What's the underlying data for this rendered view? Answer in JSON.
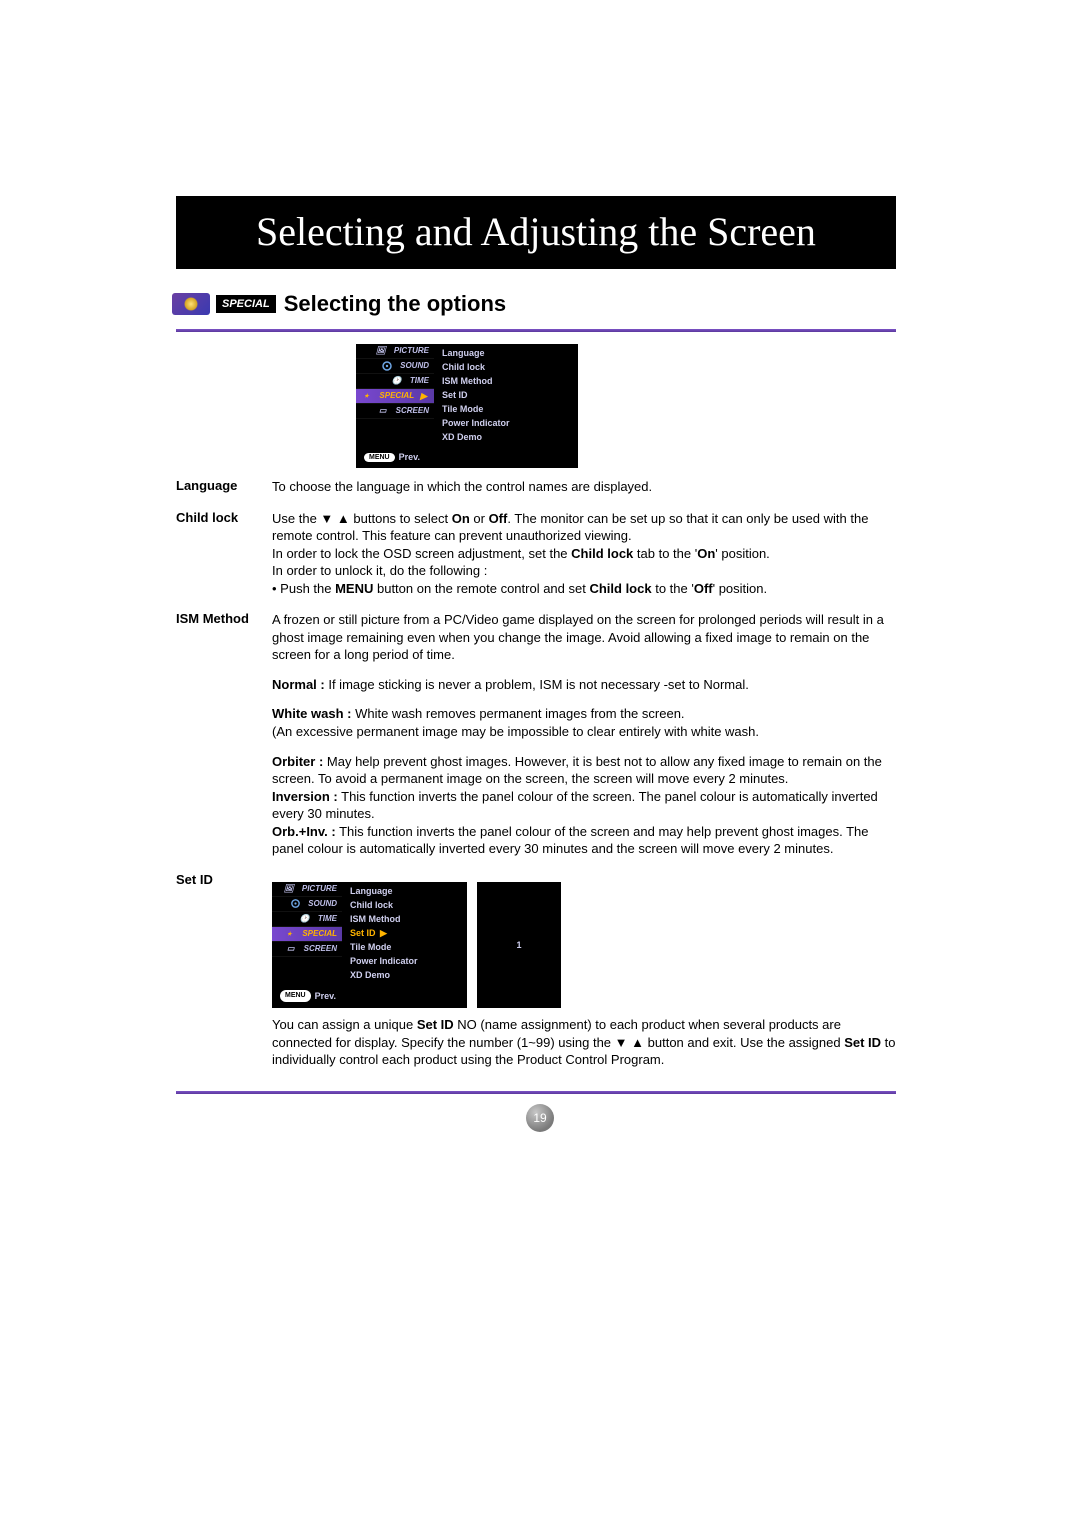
{
  "banner_title": "Selecting and Adjusting the Screen",
  "special_tag": "SPECIAL",
  "subhead_title": "Selecting the options",
  "osd_tabs": {
    "picture": "PICTURE",
    "sound": "SOUND",
    "time": "TIME",
    "special": "SPECIAL",
    "screen": "SCREEN"
  },
  "osd_items": {
    "language": "Language",
    "child_lock": "Child lock",
    "ism_method": "ISM Method",
    "set_id": "Set ID",
    "tile_mode": "Tile Mode",
    "power_indicator": "Power Indicator",
    "xd_prefix": "XD",
    "xd_demo": " Demo"
  },
  "osd_foot": {
    "menu": "MENU",
    "prev": "Prev."
  },
  "osd_set_id_value": "1",
  "labels": {
    "language": "Language",
    "child_lock": "Child lock",
    "ism_method": "ISM Method",
    "set_id": "Set ID"
  },
  "text": {
    "language_desc": "To choose the language in which the control names are displayed.",
    "child_lock_pre": "Use the ",
    "child_lock_mid1": " buttons to select ",
    "child_lock_on": "On",
    "child_lock_or": " or ",
    "child_lock_off": "Off",
    "child_lock_post1": ". The monitor can be set up so that it can only be used with the remote control. This feature can prevent unauthorized viewing.",
    "child_lock_l2a": "In order to lock the OSD screen adjustment, set the ",
    "child_lock_l2b": "Child lock",
    "child_lock_l2c": " tab to the '",
    "child_lock_l2d": "On",
    "child_lock_l2e": "' position.",
    "child_lock_l3": "In order to unlock it, do the following :",
    "child_lock_l4a": "• Push the ",
    "child_lock_l4b": "MENU",
    "child_lock_l4c": " button on the remote control and set ",
    "child_lock_l4d": "Child lock",
    "child_lock_l4e": " to the '",
    "child_lock_l4f": "Off",
    "child_lock_l4g": "' position.",
    "ism_p1": "A frozen or still picture from a PC/Video game displayed on the screen for prolonged periods will result in a ghost image remaining even when you change the image. Avoid allowing a fixed image to remain on the screen for a long period of time.",
    "ism_normal_b": "Normal :",
    "ism_normal_t": " If image sticking is never a problem, ISM is not necessary -set to Normal.",
    "ism_white_b": "White wash :",
    "ism_white_t": "  White wash removes permanent images from the screen.",
    "ism_white_t2": "(An excessive permanent image may be impossible to clear entirely with white wash.",
    "ism_orbiter_b": "Orbiter :",
    "ism_orbiter_t": " May help prevent ghost images. However, it is best not to allow any fixed image to remain on the screen. To avoid a permanent image on the screen, the screen will move every 2 minutes.",
    "ism_inversion_b": "Inversion :",
    "ism_inversion_t": " This function inverts the panel colour of the screen. The panel colour is automatically inverted every 30 minutes.",
    "ism_orbinv_b": "Orb.+Inv. :",
    "ism_orbinv_t": " This function inverts the panel colour of the screen and may help prevent ghost images. The panel colour is automatically inverted every 30 minutes and the screen will move every 2 minutes.",
    "set_id_p_a": "You can assign a unique ",
    "set_id_p_b": "Set ID",
    "set_id_p_c": " NO (name assignment) to each product when several products are connected for display. Specify the number (1~99) using the ",
    "set_id_p_d": " button and exit. Use the assigned ",
    "set_id_p_e": "Set ID",
    "set_id_p_f": " to individually control each product using the Product Control Program."
  },
  "glyphs": {
    "down": "▼",
    "up": "▲",
    "right": "▶"
  },
  "page_number": "19"
}
